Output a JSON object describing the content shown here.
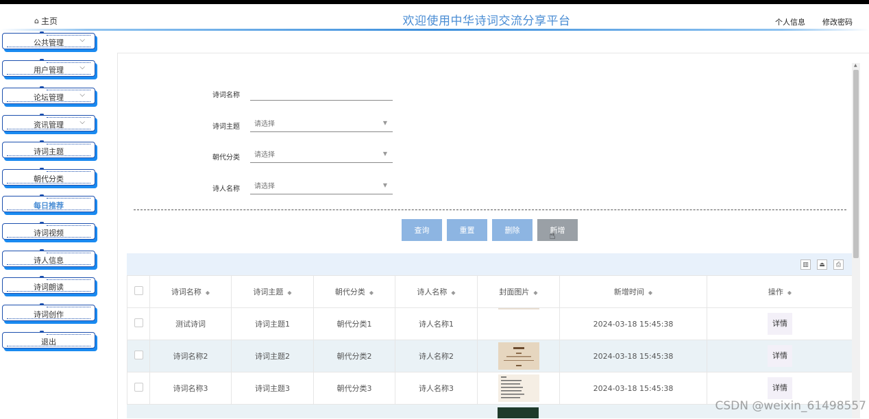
{
  "header": {
    "home_tab": "主页",
    "title": "欢迎使用中华诗词交流分享平台",
    "profile_link": "个人信息",
    "password_link": "修改密码"
  },
  "sidebar": {
    "items": [
      {
        "label": "公共管理",
        "has_chevron": true
      },
      {
        "label": "用户管理",
        "has_chevron": true
      },
      {
        "label": "论坛管理",
        "has_chevron": true
      },
      {
        "label": "资讯管理",
        "has_chevron": true
      },
      {
        "label": "诗词主题"
      },
      {
        "label": "朝代分类"
      },
      {
        "label": "每日推荐",
        "active": true
      },
      {
        "label": "诗词视频"
      },
      {
        "label": "诗人信息"
      },
      {
        "label": "诗词朗读"
      },
      {
        "label": "诗词创作"
      },
      {
        "label": "退出"
      }
    ]
  },
  "search_form": {
    "name_label": "诗词名称",
    "name_value": "",
    "theme_label": "诗词主题",
    "theme_placeholder": "请选择",
    "dynasty_label": "朝代分类",
    "dynasty_placeholder": "请选择",
    "poet_label": "诗人名称",
    "poet_placeholder": "请选择"
  },
  "buttons": {
    "query": "查询",
    "reset": "重置",
    "delete": "删除",
    "add": "新增"
  },
  "table": {
    "headers": [
      "诗词名称",
      "诗词主题",
      "朝代分类",
      "诗人名称",
      "封面图片",
      "新增时间",
      "操作"
    ],
    "detail_label": "详情",
    "rows": [
      {
        "name": "测试诗词",
        "theme": "诗词主题1",
        "dynasty": "朝代分类1",
        "poet": "诗人名称1",
        "time": "2024-03-18 15:45:38"
      },
      {
        "name": "诗词名称2",
        "theme": "诗词主题2",
        "dynasty": "朝代分类2",
        "poet": "诗人名称2",
        "time": "2024-03-18 15:45:38"
      },
      {
        "name": "诗词名称3",
        "theme": "诗词主题3",
        "dynasty": "朝代分类3",
        "poet": "诗人名称3",
        "time": "2024-03-18 15:45:38"
      }
    ]
  },
  "watermark": "CSDN @weixin_61498557",
  "colors": {
    "accent": "#4a8dd4",
    "menu_border": "#1b4fae",
    "menu_shadow": "#1a8af0",
    "button_blue": "#8db5e2",
    "toolbar_bg": "#e8f1fb"
  }
}
